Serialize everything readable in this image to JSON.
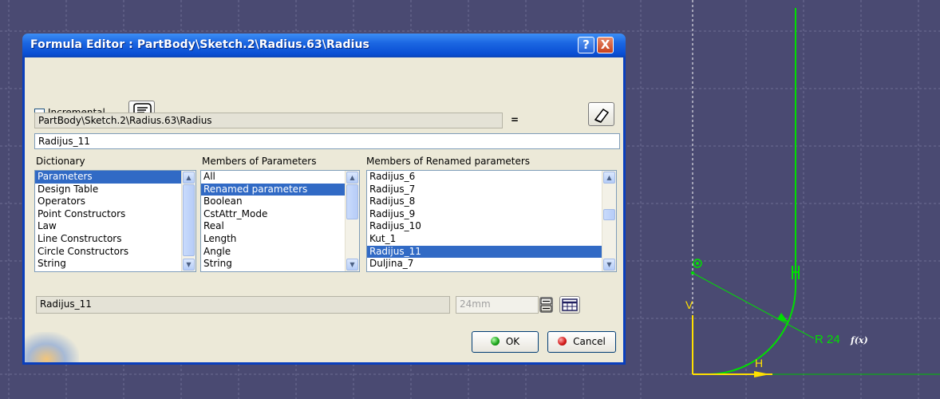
{
  "dialog": {
    "title": "Formula Editor : PartBody\\Sketch.2\\Radius.63\\Radius",
    "help_label": "?",
    "close_label": "X",
    "incremental_label": "Incremental",
    "incremental_checked": false,
    "parameter_path": "PartBody\\Sketch.2\\Radius.63\\Radius",
    "equals_label": "=",
    "formula_value": "Radijus_11",
    "dictionary": {
      "label": "Dictionary",
      "items": [
        "Parameters",
        "Design Table",
        "Operators",
        "Point Constructors",
        "Law",
        "Line Constructors",
        "Circle Constructors",
        "String"
      ],
      "selected_index": 0
    },
    "members": {
      "label": "Members of Parameters",
      "items": [
        "All",
        "Renamed parameters",
        "Boolean",
        "CstAttr_Mode",
        "Real",
        "Length",
        "Angle",
        "String"
      ],
      "selected_index": 1
    },
    "renamed": {
      "label": "Members of Renamed parameters",
      "items": [
        "Radijus_6",
        "Radijus_7",
        "Radijus_8",
        "Radijus_9",
        "Radijus_10",
        "Kut_1",
        "Radijus_11",
        "Duljina_7"
      ],
      "selected_index": 6
    },
    "selected_param": "Radijus_11",
    "value_field": "24mm",
    "ok_label": "OK",
    "cancel_label": "Cancel"
  },
  "sketch": {
    "dimension_label": "R 24",
    "formula_icon": "f(x)",
    "h_constraint": "H",
    "v_constraint": "V"
  },
  "colors": {
    "background": "#4a4a72",
    "grid": "#6e6e94",
    "sketch_curve": "#00e000",
    "constraint": "#ffe000",
    "title_bar": "#0a4fd4"
  }
}
